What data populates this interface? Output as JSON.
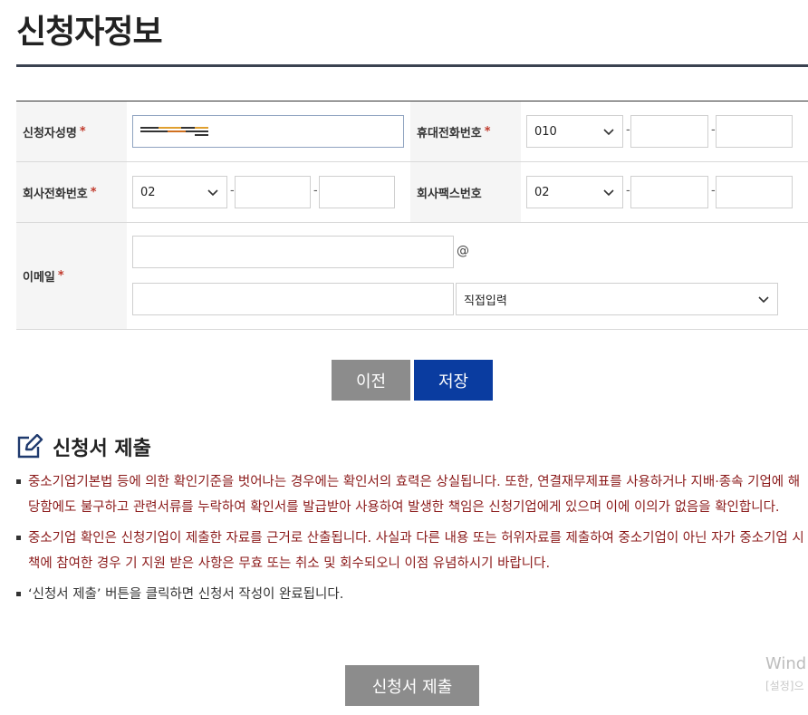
{
  "page": {
    "title": "신청자정보"
  },
  "form": {
    "required_mark": "*",
    "dash": "-",
    "at_sign": "@",
    "applicant_name": {
      "label": "신청자성명",
      "value": ""
    },
    "mobile": {
      "label": "휴대전화번호",
      "prefix": "010",
      "middle": "",
      "last": ""
    },
    "company_phone": {
      "label": "회사전화번호",
      "prefix": "02",
      "middle": "",
      "last": ""
    },
    "company_fax": {
      "label": "회사팩스번호",
      "prefix": "02",
      "middle": "",
      "last": ""
    },
    "email": {
      "label": "이메일",
      "local": "",
      "domain": "",
      "domain_select": "직접입력"
    }
  },
  "buttons": {
    "prev": "이전",
    "save": "저장",
    "submit": "신청서 제출"
  },
  "section": {
    "title": "신청서 제출",
    "icon": "edit-icon"
  },
  "notices": [
    {
      "text": "중소기업기본법 등에 의한 확인기준을 벗어나는 경우에는 확인서의 효력은 상실됩니다. 또한, 연결재무제표를 사용하거나 지배·종속 기업에 해당함에도 불구하고 관련서류를 누락하여 확인서를 발급받아 사용하여 발생한 책임은 신청기업에게 있으며 이에 이의가 없음을 확인합니다.",
      "color": "#8b1a1a"
    },
    {
      "text": "중소기업 확인은 신청기업이 제출한 자료를 근거로 산출됩니다. 사실과 다른 내용 또는 허위자료를 제출하여 중소기업이 아닌 자가 중소기업 시책에 참여한 경우 기 지원 받은 사항은 무효 또는 취소 및 회수되오니 이점 유념하시기 바랍니다.",
      "color": "#8b1a1a"
    },
    {
      "text": "‘신청서 제출’ 버튼을 클릭하면 신청서 작성이 완료됩니다.",
      "color": "#333333"
    }
  ],
  "watermark": {
    "line1": "Wind",
    "line2": "[설정]으"
  }
}
